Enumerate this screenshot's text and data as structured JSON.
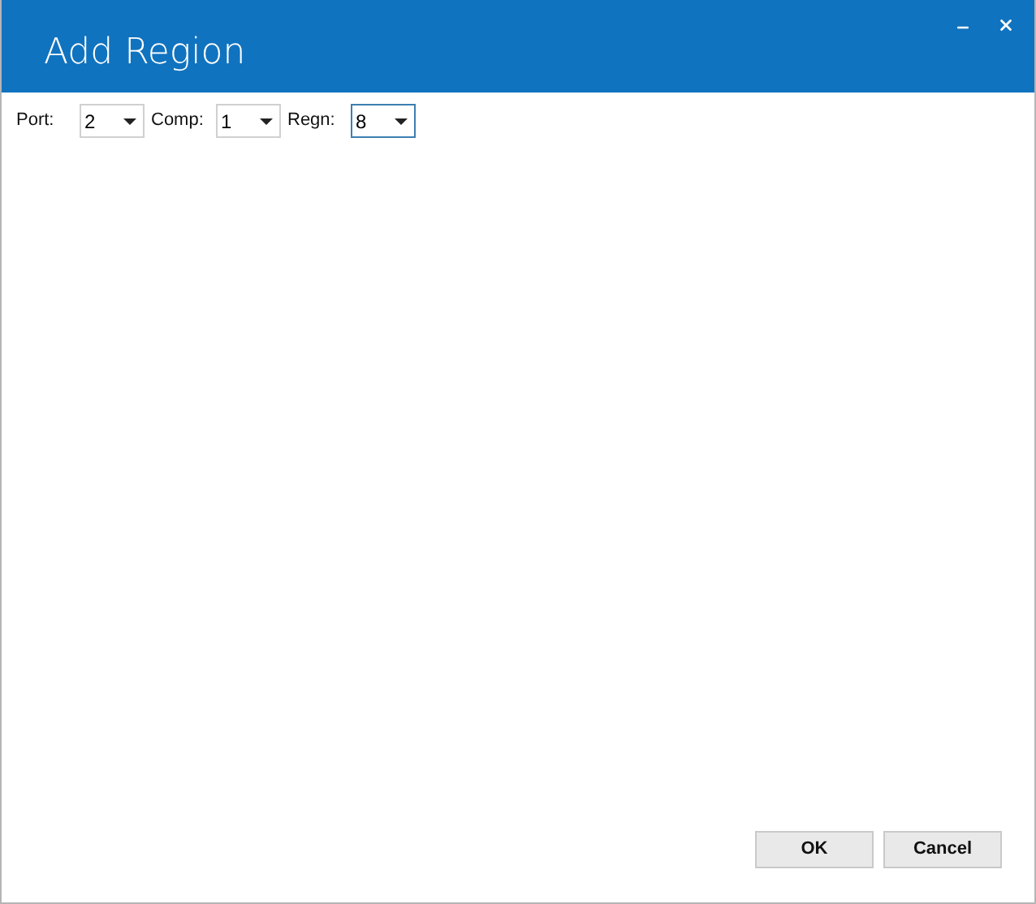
{
  "window": {
    "title": "Add Region"
  },
  "fields": [
    {
      "label": "Port:",
      "value": "2",
      "focused": false
    },
    {
      "label": "Comp:",
      "value": "1",
      "focused": false
    },
    {
      "label": "Regn:",
      "value": "8",
      "focused": true
    }
  ],
  "buttons": [
    "OK",
    "Cancel"
  ]
}
